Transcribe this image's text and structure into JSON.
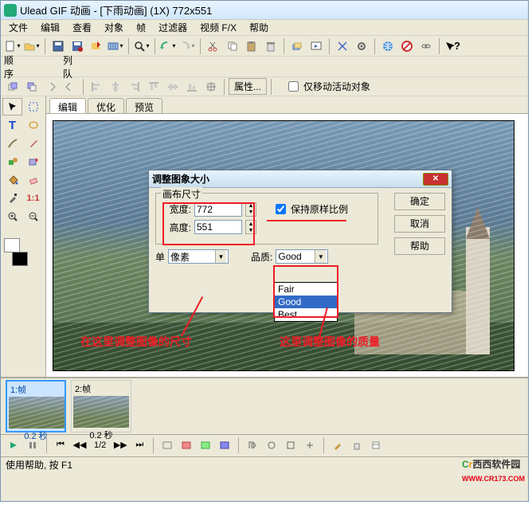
{
  "titlebar": {
    "text": "Ulead GIF 动画 - [下雨动画] (1X) 772x551"
  },
  "menus": [
    "文件",
    "编辑",
    "查看",
    "对象",
    "帧",
    "过滤器",
    "视频 F/X",
    "帮助"
  ],
  "toolbar2": {
    "labels": [
      "顺序",
      "列队"
    ],
    "prop_btn": "属性...",
    "checkbox": "仅移动活动对象"
  },
  "colors": {
    "accent_red": "#ee1c25"
  },
  "tabs": [
    "编辑",
    "优化",
    "预览"
  ],
  "dialog": {
    "title": "调整图象大小",
    "fieldset": "画布尺寸",
    "width_label": "宽度:",
    "width_value": "772",
    "height_label": "高度:",
    "height_value": "551",
    "keep_ratio": "保持原样比例",
    "unit_label": "单",
    "unit_value": "像素",
    "quality_label": "品质:",
    "quality_value": "Good",
    "quality_options": [
      "Fair",
      "Good",
      "Best"
    ],
    "buttons": {
      "ok": "确定",
      "cancel": "取消",
      "help": "帮助"
    }
  },
  "annotations": {
    "size_note": "在这里调整图像的尺寸",
    "quality_note": "这里调整图像的质量"
  },
  "frames": [
    {
      "label": "1:帧",
      "time": "0.2 秒"
    },
    {
      "label": "2:帧",
      "time": "0.2 秒"
    }
  ],
  "playback": {
    "counter": "1/2"
  },
  "statusbar": {
    "text": "使用帮助, 按 F1"
  },
  "watermark": {
    "text1": "西西软件园",
    "text2": "WWW.CR173.COM"
  }
}
